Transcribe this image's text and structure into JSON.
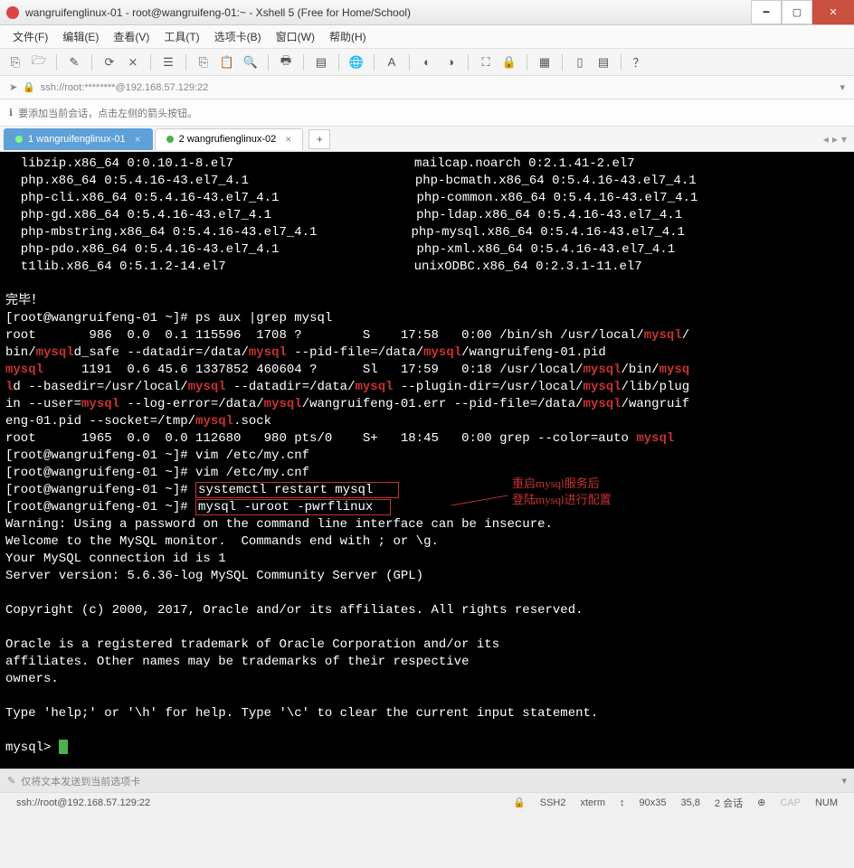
{
  "window": {
    "title": "wangruifenglinux-01 - root@wangruifeng-01:~ - Xshell 5 (Free for Home/School)"
  },
  "menu": {
    "file": "文件(F)",
    "edit": "编辑(E)",
    "view": "查看(V)",
    "tools": "工具(T)",
    "tab": "选项卡(B)",
    "window": "窗口(W)",
    "help": "帮助(H)"
  },
  "address": {
    "text": "ssh://root:********@192.168.57.129:22"
  },
  "hint": {
    "text": "要添加当前会话，点击左侧的箭头按钮。"
  },
  "tabs": {
    "t1": "1 wangruifenglinux-01",
    "t2": "2 wangrufienglinux-02",
    "add": "+"
  },
  "terminal": {
    "pkg_l1a": "  libzip.x86_64 0:0.10.1-8.el7",
    "pkg_l1b": "mailcap.noarch 0:2.1.41-2.el7",
    "pkg_l2a": "  php.x86_64 0:5.4.16-43.el7_4.1",
    "pkg_l2b": "php-bcmath.x86_64 0:5.4.16-43.el7_4.1",
    "pkg_l3a": "  php-cli.x86_64 0:5.4.16-43.el7_4.1",
    "pkg_l3b": "php-common.x86_64 0:5.4.16-43.el7_4.1",
    "pkg_l4a": "  php-gd.x86_64 0:5.4.16-43.el7_4.1",
    "pkg_l4b": "php-ldap.x86_64 0:5.4.16-43.el7_4.1",
    "pkg_l5a": "  php-mbstring.x86_64 0:5.4.16-43.el7_4.1",
    "pkg_l5b": "php-mysql.x86_64 0:5.4.16-43.el7_4.1",
    "pkg_l6a": "  php-pdo.x86_64 0:5.4.16-43.el7_4.1",
    "pkg_l6b": "php-xml.x86_64 0:5.4.16-43.el7_4.1",
    "pkg_l7a": "  t1lib.x86_64 0:5.1.2-14.el7",
    "pkg_l7b": "unixODBC.x86_64 0:2.3.1-11.el7",
    "done": "完毕！",
    "prompt": "[root@wangruifeng-01 ~]# ",
    "cmd_ps": "ps aux |grep mysql",
    "ps1_a": "root       986  0.0  0.1 115596  1708 ?        S    17:58   0:00 /bin/sh /usr/local/",
    "ps1_b": "/",
    "ps2_a": "bin/",
    "ps2_b": "d_safe --datadir=/data/",
    "ps2_c": " --pid-file=/data/",
    "ps2_d": "/wangruifeng-01.pid",
    "ps3_a": "     1191  0.6 45.6 1337852 460604 ?      Sl   17:59   0:18 /usr/local/",
    "ps3_b": "/bin/",
    "ps4_a": "d --basedir=/usr/local/",
    "ps4_b": " --datadir=/data/",
    "ps4_c": " --plugin-dir=/usr/local/",
    "ps4_d": "/lib/plug",
    "ps5_a": "in --user=",
    "ps5_b": " --log-error=/data/",
    "ps5_c": "/wangruifeng-01.err --pid-file=/data/",
    "ps5_d": "/wangruif",
    "ps6_a": "eng-01.pid --socket=/tmp/",
    "ps6_b": ".sock",
    "ps7_a": "root      1965  0.0  0.0 112680   980 pts/0    S+   18:45   0:00 grep --color=auto ",
    "cmd_vim1": "vim /etc/my.cnf",
    "cmd_vim2": "vim /etc/my.cnf",
    "cmd_restart": "systemctl restart mysql",
    "cmd_login": "mysql -uroot -pwrflinux",
    "warn": "Warning: Using a password on the command line interface can be insecure.",
    "welcome": "Welcome to the MySQL monitor.  Commands end with ; or \\g.",
    "connid": "Your MySQL connection id is 1",
    "version": "Server version: 5.6.36-log MySQL Community Server (GPL)",
    "copyright": "Copyright (c) 2000, 2017, Oracle and/or its affiliates. All rights reserved.",
    "trade1": "Oracle is a registered trademark of Oracle Corporation and/or its",
    "trade2": "affiliates. Other names may be trademarks of their respective",
    "trade3": "owners.",
    "help": "Type 'help;' or '\\h' for help. Type '\\c' to clear the current input statement.",
    "sqlprompt": "mysql> ",
    "kw_mysql": "mysql",
    "kw_mysqld": "mysql",
    "kw_mysq": "mysq",
    "kw_l": "l",
    "anno1": "重启mysql服务后",
    "anno2": "登陆mysql进行配置"
  },
  "sendbar": {
    "text": "仅将文本发送到当前选项卡"
  },
  "status": {
    "conn": "ssh://root@192.168.57.129:22",
    "ssh": "SSH2",
    "term": "xterm",
    "size": "90x35",
    "pos": "35,8",
    "sessions": "2 会话",
    "cap": "CAP",
    "num": "NUM"
  }
}
